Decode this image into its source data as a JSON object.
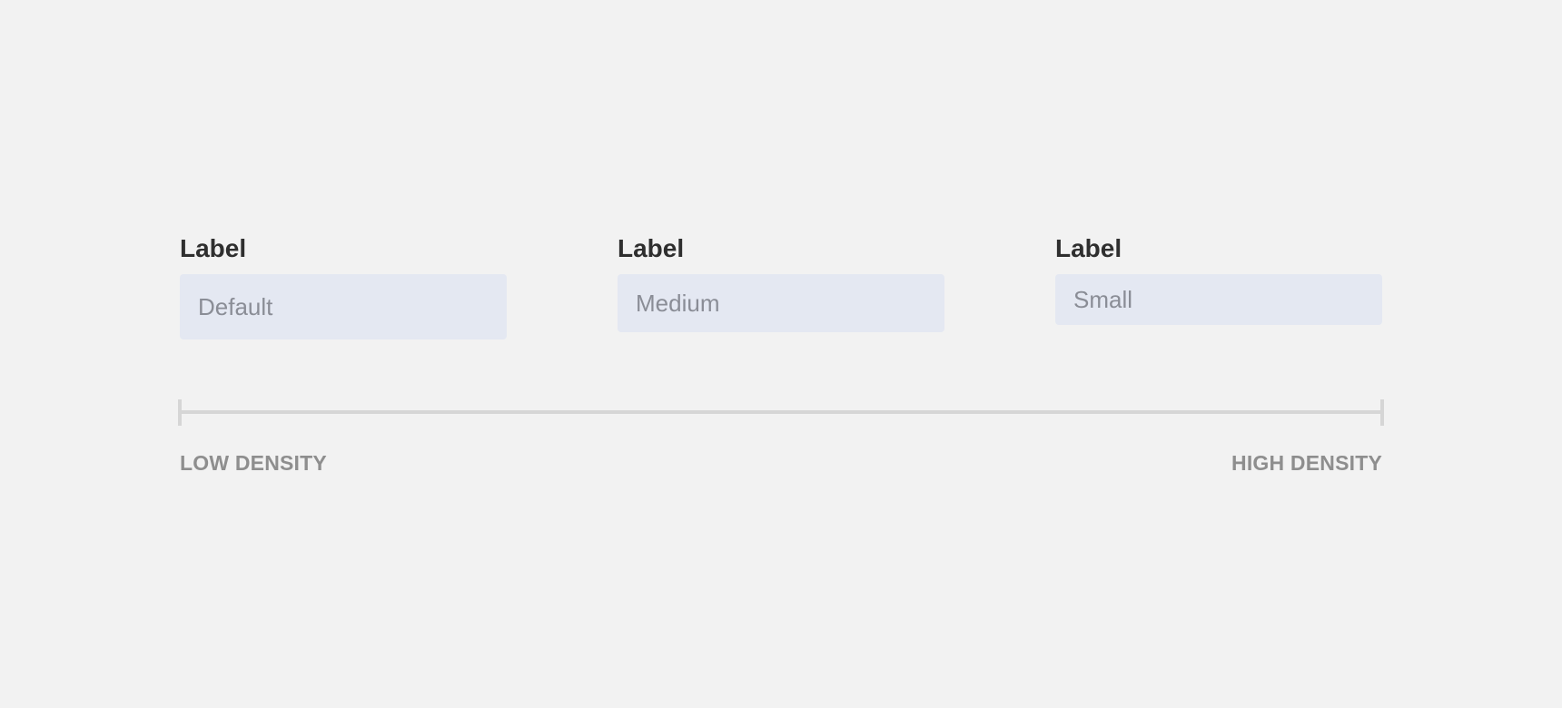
{
  "fields": [
    {
      "label": "Label",
      "placeholder": "Default"
    },
    {
      "label": "Label",
      "placeholder": "Medium"
    },
    {
      "label": "Label",
      "placeholder": "Small"
    }
  ],
  "scale": {
    "left_label": "LOW DENSITY",
    "right_label": "HIGH DENSITY"
  },
  "colors": {
    "background": "#f2f2f2",
    "input_background": "#e4e8f2",
    "label_text": "#2f2f2f",
    "placeholder_text": "#8a8d96",
    "scale_line": "#d6d6d6",
    "density_text": "#8e8e8e"
  }
}
